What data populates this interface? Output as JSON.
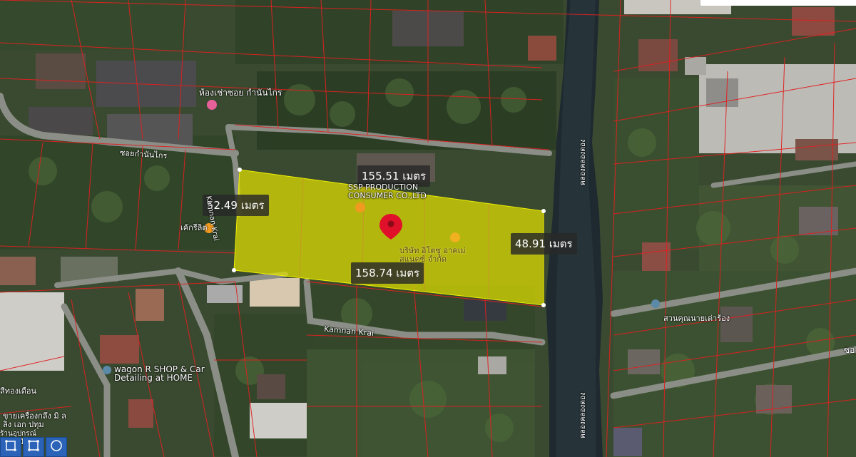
{
  "measurements": {
    "top_edge": "155.51 เมตร",
    "left_edge": "52.49 เมตร",
    "right_edge": "48.91 เมตร",
    "bottom_edge": "158.74 เมตร"
  },
  "pois": {
    "room_rental": "ห้องเช่าซอย กำนันไกร",
    "cafe": "เค้กรีลิต",
    "company": "SSP PRODUCTION CONSUMER CO.,LTD",
    "company_thai": "บริษัท อิโตซู อาคเม่ สแนคซ์ จำกัด",
    "garden": "สวนคุณนายเต่าร้อง",
    "car_shop": "wagon R SHOP & Car Detailing at HOME",
    "shop_left": "สีทองเดือน",
    "shop_bottom": "ขายเครื่องกลึง มิ ลลิ่ง เอก ปทุม",
    "shop_bottom2": "ร้านอุปกรณ์ เครื่องมือ"
  },
  "roads": {
    "soi_kamnan": "ซอยกำนันไกร",
    "kamnan_krai": "Kamnan Krai",
    "kamnan_vertical": "Kamnan Krai",
    "canal": "คลองคลองดอง",
    "canal2": "คลองคลองดอง",
    "right_edge": "ซอ"
  },
  "toolbar": {
    "tools": [
      "square-icon",
      "polygon-icon",
      "circle-icon"
    ]
  },
  "colors": {
    "parcel_highlight": "#e0e000",
    "parcel_lines": "#e02020",
    "pin": "#e0102a"
  }
}
